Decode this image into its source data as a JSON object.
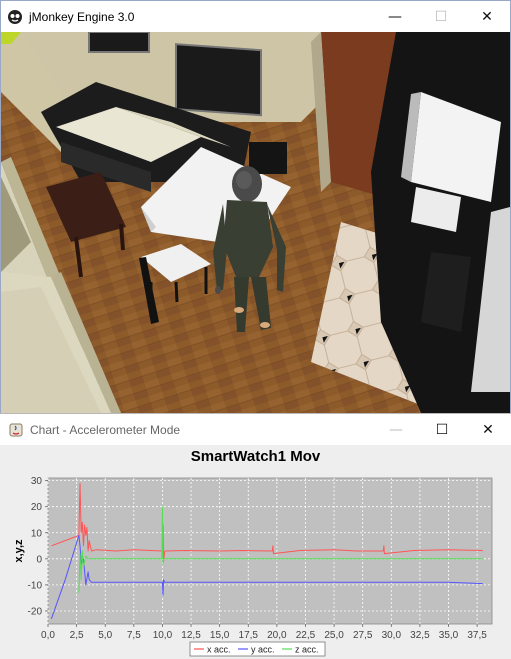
{
  "main_window": {
    "title": "jMonkey Engine 3.0",
    "controls": {
      "minimize": "—",
      "maximize": "☐",
      "close": "✕"
    }
  },
  "chart_window": {
    "title": "Chart - Accelerometer Mode",
    "controls": {
      "minimize": "—",
      "maximize": "☐",
      "close": "✕"
    }
  },
  "chart_data": {
    "type": "line",
    "title": "SmartWatch1 Mov",
    "xlabel": "---",
    "ylabel": "x,y,z",
    "xlim": [
      0,
      38.8
    ],
    "ylim": [
      -25,
      31
    ],
    "grid": true,
    "legend_position": "bottom",
    "x_ticks": [
      "0,0",
      "2,5",
      "5,0",
      "7,5",
      "10,0",
      "12,5",
      "15,0",
      "17,5",
      "20,0",
      "22,5",
      "25,0",
      "27,5",
      "30,0",
      "32,5",
      "35,0",
      "37,5"
    ],
    "y_ticks": [
      "30",
      "20",
      "10",
      "0",
      "-10",
      "-20"
    ],
    "series": [
      {
        "name": "x acc.",
        "color": "#ff5555",
        "x": [
          0.3,
          1.5,
          2.7,
          2.8,
          2.9,
          3.0,
          3.1,
          3.2,
          3.3,
          3.4,
          3.5,
          3.6,
          3.8,
          4.2,
          6,
          7.5,
          10,
          10.05,
          10.1,
          10.2,
          12,
          15,
          17,
          19.6,
          19.65,
          19.7,
          22,
          25,
          27,
          29.3,
          29.35,
          29.4,
          32,
          35,
          38
        ],
        "y": [
          5,
          7,
          9,
          29,
          10,
          14,
          5,
          13,
          9,
          12,
          3,
          7,
          3,
          3.5,
          3,
          3.5,
          3,
          13,
          -1,
          3,
          3.2,
          3,
          3.2,
          3,
          5,
          2,
          3.2,
          3.5,
          3,
          3,
          5,
          2,
          3.2,
          3.5,
          3.2
        ]
      },
      {
        "name": "y acc.",
        "color": "#5555ff",
        "x": [
          0.3,
          1.5,
          2.7,
          2.8,
          2.9,
          3.1,
          3.3,
          3.5,
          3.6,
          3.8,
          5,
          7.5,
          10,
          10.05,
          10.1,
          10.2,
          12,
          15,
          17.5,
          20,
          22.5,
          25,
          27.5,
          30,
          32.5,
          35,
          38
        ],
        "y": [
          -23,
          -8,
          9,
          5,
          -2,
          0,
          -10,
          -5,
          -8,
          -9,
          -9,
          -9,
          -9,
          -14,
          -8,
          -9,
          -9,
          -9,
          -9,
          -9,
          -9,
          -9,
          -9,
          -9,
          -9,
          -9,
          -9.5
        ]
      },
      {
        "name": "z acc.",
        "color": "#55dd55",
        "x": [
          2.7,
          2.8,
          2.9,
          3.0,
          3.1,
          3.3,
          3.5,
          3.8,
          5,
          7.5,
          9.95,
          10.0,
          10.05,
          10.1,
          12,
          15,
          17.5,
          20,
          22.5,
          25,
          27.5,
          30,
          32.5,
          35,
          38
        ],
        "y": [
          -13,
          2,
          -8,
          3,
          -3,
          1,
          0,
          0,
          0,
          0,
          0,
          20,
          -2,
          0,
          0,
          0,
          0,
          0,
          0,
          0,
          0,
          0,
          0,
          0,
          0
        ]
      }
    ]
  }
}
